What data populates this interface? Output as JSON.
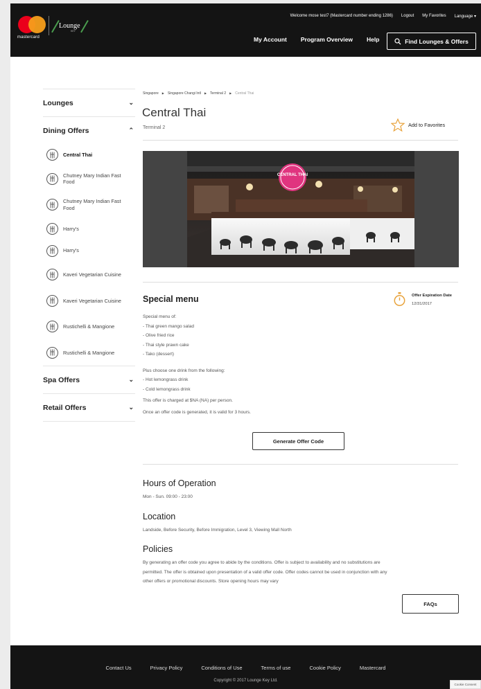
{
  "header": {
    "brand_name": "mastercard",
    "partner_logo_text": "Lounge",
    "partner_logo_sub": "KEY",
    "utility": {
      "welcome": "Welcome mose test7  (Mastercard number ending 1286)",
      "logout": "Logout",
      "favorites": "My Favorites",
      "language": "Language ▾"
    },
    "nav": {
      "my_account": "My Account",
      "program_overview": "Program Overview",
      "help": "Help"
    },
    "find_button": "Find Lounges & Offers"
  },
  "sidebar": {
    "lounges": "Lounges",
    "dining_offers": "Dining Offers",
    "dining_items": [
      {
        "label": "Central Thai",
        "active": true
      },
      {
        "label": "Chutney Mary Indian Fast Food"
      },
      {
        "label": "Chutney Mary Indian Fast Food"
      },
      {
        "label": "Harry's"
      },
      {
        "label": "Harry's"
      },
      {
        "label": "Kaveri Vegetarian Cuisine"
      },
      {
        "label": "Kaveri Vegetarian Cuisine"
      },
      {
        "label": "Rustichelli & Mangione"
      },
      {
        "label": "Rustichelli & Mangione"
      }
    ],
    "spa_offers": "Spa Offers",
    "retail_offers": "Retail Offers"
  },
  "breadcrumb": {
    "items": [
      "Singapore",
      "Singapore Changi Intl",
      "Terminal 2"
    ],
    "current": "Central Thai"
  },
  "title": "Central Thai",
  "subtitle": "Terminal 2",
  "favorite_label": "Add to Favorites",
  "hero_sign_text": "CENTRAL THAI",
  "special_menu": {
    "title": "Special menu",
    "expiration_label": "Offer Expiration Date",
    "expiration_date": "12/31/2017",
    "intro": "Special menu of:",
    "items": [
      "- Thai green mango salad",
      "- Olive fried rice",
      "- Thai style prawn cake",
      "- Tako (dessert)"
    ],
    "drink_intro": "Plus choose one drink from the following:",
    "drinks": [
      "- Hot lemongrass drink",
      "- Cold lemongrass drink"
    ],
    "charge": "This offer is charged at $NA (NA) per person.",
    "validity": "Once an offer code is generated, it is valid for 3 hours."
  },
  "generate_button": "Generate Offer Code",
  "hours": {
    "title": "Hours of Operation",
    "text": "Mon - Sun. 09:00 - 23:00"
  },
  "location": {
    "title": "Location",
    "text": "Landside, Before Security, Before Immigration, Level 3, Viewing Mall North"
  },
  "policies": {
    "title": "Policies",
    "lines": [
      "By generating an offer code you agree to abide by the conditions. Offer is subject to availability and no substitutions are",
      "permitted. The offer is obtained upon presentation of a valid offer code. Offer codes cannot be used in conjunction with any",
      "other offers or promotional discounts. Store opening hours may vary"
    ]
  },
  "faq_button": "FAQs",
  "footer": {
    "links": [
      "Contact Us",
      "Privacy Policy",
      "Conditions of Use",
      "Terms of use",
      "Cookie Policy",
      "Mastercard"
    ],
    "copyright": "Copyright © 2017 Lounge Key Ltd."
  },
  "cookie_consent": "Cookie Consent",
  "colors": {
    "header_bg": "#141414",
    "mc_red": "#eb001b",
    "mc_yellow": "#f79e1b",
    "accent_orange": "#e8a33c",
    "sign_pink": "#e0347f"
  }
}
